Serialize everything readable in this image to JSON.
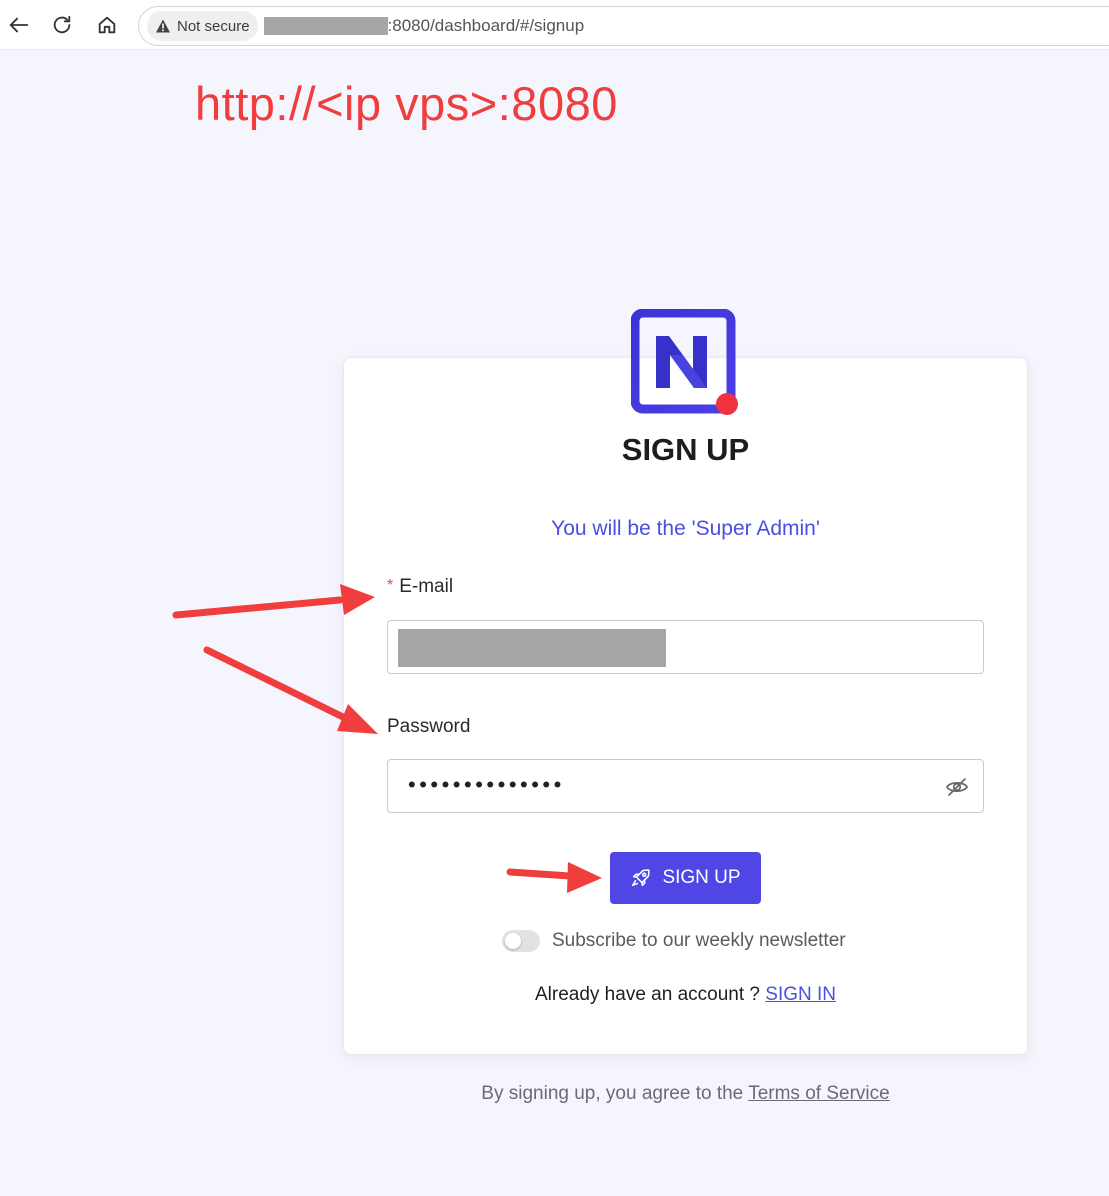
{
  "browser": {
    "security_label": "Not secure",
    "url_suffix": ":8080/dashboard/#/signup"
  },
  "annotation": {
    "url_hint": "http://<ip vps>:8080"
  },
  "form": {
    "title": "SIGN UP",
    "subtitle": "You will be the 'Super Admin'",
    "email_label": "E-mail",
    "password_label": "Password",
    "password_value": "••••••••••••••",
    "submit_label": "SIGN UP",
    "newsletter_label": "Subscribe to our weekly newsletter",
    "newsletter_enabled": false,
    "have_account_text": "Already have an account ?",
    "sign_in_link": "SIGN IN"
  },
  "footer": {
    "terms_prefix": "By signing up, you agree to the",
    "terms_link": "Terms of Service"
  },
  "colors": {
    "accent": "#4f46e5",
    "annotation": "#f03d3d",
    "logo_dot": "#f0313f"
  },
  "icons": {
    "back": "back-arrow-icon",
    "reload": "reload-icon",
    "home": "home-icon",
    "warning": "warning-icon",
    "eye": "eye-slash-icon",
    "rocket": "rocket-icon"
  }
}
